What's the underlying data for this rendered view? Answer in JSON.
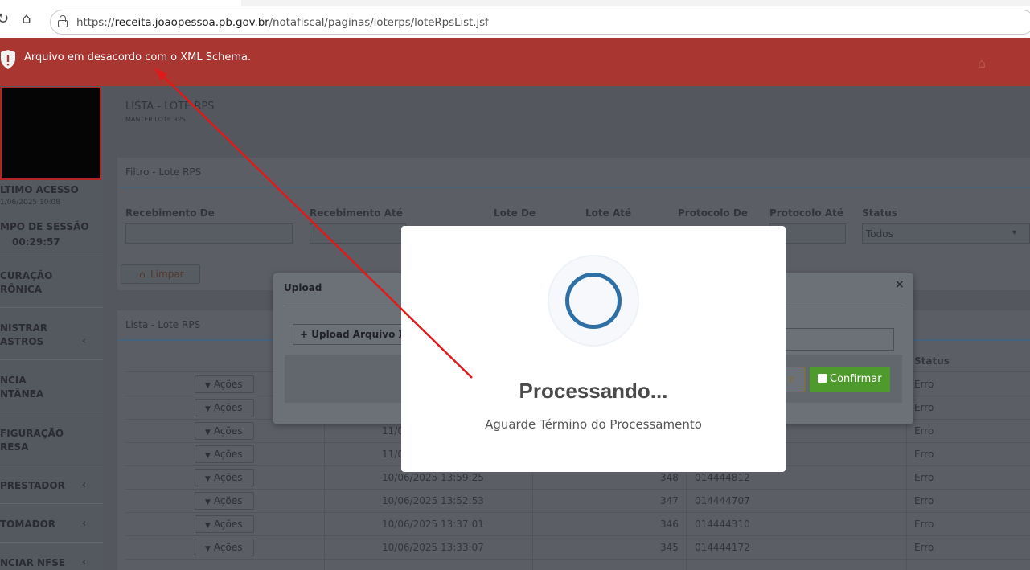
{
  "browser": {
    "url_host": "receita.joaopessoa.pb.gov.br",
    "url_scheme": "https://",
    "url_path": "/notafiscal/paginas/loterps/loteRpsList.jsf"
  },
  "error_banner": {
    "message": "Arquivo em desacordo com o XML Schema.",
    "color": "#a93630"
  },
  "sidebar": {
    "ultimo_acesso_label": "LTIMO ACESSO",
    "ultimo_acesso_value": "1/06/2025 10:08",
    "tempo_sessao_label": "MPO DE SESSÃO",
    "tempo_sessao_value": "00:29:57",
    "items": [
      {
        "line1": "CURAÇÃO",
        "line2": "RÔNICA",
        "chevron": false
      },
      {
        "line1": "NISTRAR",
        "line2": "ASTROS",
        "chevron": true
      },
      {
        "line1": "NCIA",
        "line2": "NTÂNEA",
        "chevron": false
      },
      {
        "line1": "FIGURAÇÃO",
        "line2": "RESA",
        "chevron": false
      },
      {
        "line1": "PRESTADOR",
        "line2": "",
        "chevron": true
      },
      {
        "line1": "TOMADOR",
        "line2": "",
        "chevron": true
      },
      {
        "line1": "NCIAR NFSE",
        "line2": "",
        "chevron": true
      }
    ]
  },
  "main": {
    "page_title": "LISTA - LOTE RPS",
    "page_subtitle": "MANTER LOTE RPS",
    "filter_title": "Filtro - Lote RPS",
    "filter_labels": [
      "Recebimento De",
      "Recebimento Até",
      "Lote De",
      "Lote Até",
      "Protocolo De",
      "Protocolo Até",
      "Status"
    ],
    "status_value": "Todos",
    "limpar_label": "Limpar",
    "list_title": "Lista - Lote RPS",
    "status_header": "Status",
    "action_label": "Ações",
    "rows": [
      {
        "date": "",
        "lote": "",
        "protocolo": "",
        "status": "Erro"
      },
      {
        "date": "",
        "lote": "",
        "protocolo": "",
        "status": "Erro"
      },
      {
        "date": "11/0",
        "lote": "",
        "protocolo": "",
        "status": "Erro"
      },
      {
        "date": "11/0",
        "lote": "",
        "protocolo": "",
        "status": "Erro"
      },
      {
        "date": "10/06/2025 13:59:25",
        "lote": "348",
        "protocolo": "014444812",
        "status": "Erro"
      },
      {
        "date": "10/06/2025 13:52:53",
        "lote": "347",
        "protocolo": "014444707",
        "status": "Erro"
      },
      {
        "date": "10/06/2025 13:37:01",
        "lote": "346",
        "protocolo": "014444310",
        "status": "Erro"
      },
      {
        "date": "10/06/2025 13:33:07",
        "lote": "345",
        "protocolo": "014444172",
        "status": "Erro"
      }
    ]
  },
  "upload_dialog": {
    "title": "Upload",
    "close": "×",
    "upload_button": "Upload Arquivo XML",
    "cancel_label": "r",
    "confirm_label": "Confirmar",
    "confirm_color": "#4f9a2d"
  },
  "processing": {
    "title": "Processando...",
    "subtitle": "Aguarde Término do Processamento",
    "spinner_color": "#2e6fa5"
  }
}
